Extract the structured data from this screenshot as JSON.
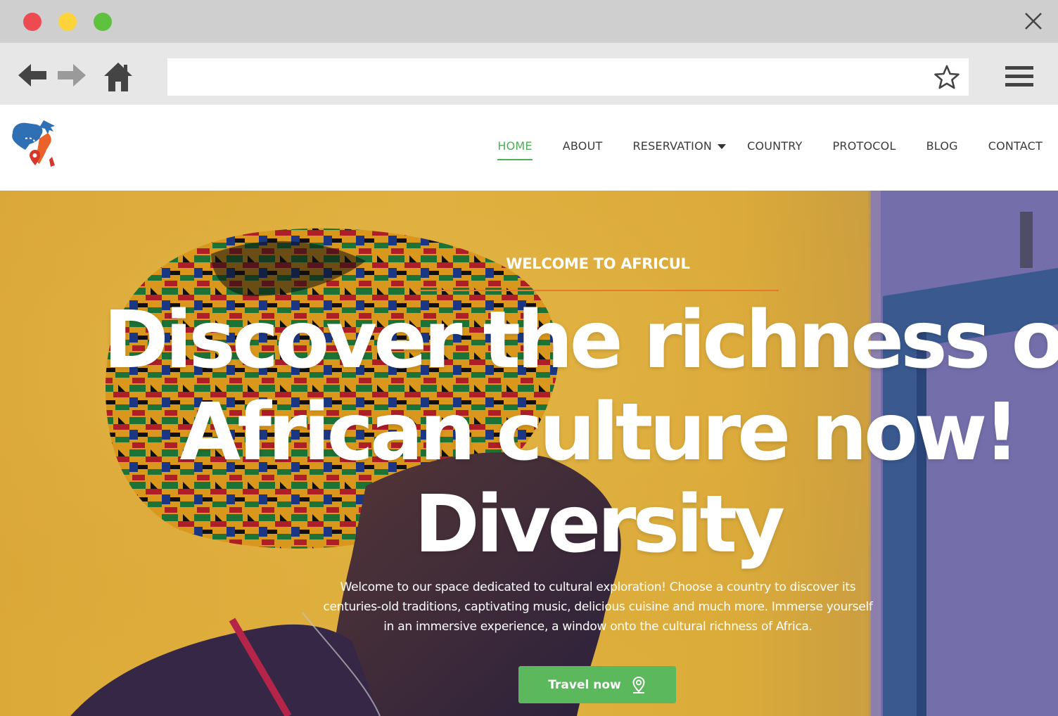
{
  "browser": {
    "url": ""
  },
  "site": {
    "nav": [
      {
        "label": "HOME",
        "active": true
      },
      {
        "label": "ABOUT",
        "active": false
      },
      {
        "label": "RESERVATION",
        "active": false,
        "has_dropdown": true
      },
      {
        "label": "COUNTRY",
        "active": false
      },
      {
        "label": "PROTOCOL",
        "active": false
      },
      {
        "label": "BLOG",
        "active": false
      },
      {
        "label": "CONTACT",
        "active": false
      }
    ]
  },
  "hero": {
    "eyebrow": "WELCOME TO AFRICUL",
    "headline_line1": "Discover the richness of",
    "headline_line2": "African culture now!",
    "headline_line3": "Diversity",
    "intro_line1": "Welcome to our space dedicated to cultural exploration! Choose a country to discover its",
    "intro_line2": "centuries-old traditions, captivating music, delicious cuisine and much more. Immerse yourself",
    "intro_line3": "in an immersive experience, a window onto the cultural richness of Africa.",
    "cta_label": "Travel now",
    "cta_icon": "location-pin-icon"
  },
  "colors": {
    "accent_green": "#4fae57",
    "button_green": "#5cb85c",
    "eyebrow_line": "#e67a2c"
  }
}
